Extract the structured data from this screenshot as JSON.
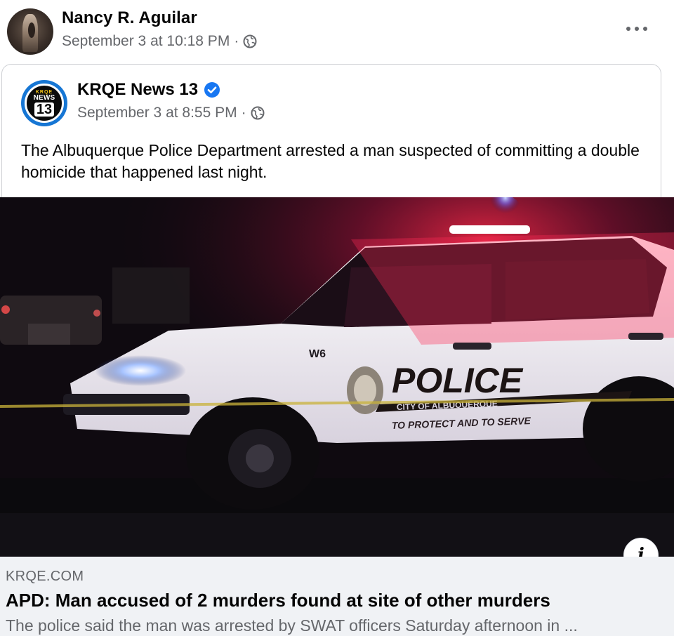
{
  "post": {
    "author_name": "Nancy R. Aguilar",
    "timestamp": "September 3 at 10:18 PM",
    "meta_separator": "·",
    "privacy_icon": "globe-icon",
    "more_icon": "more-options-icon"
  },
  "shared": {
    "page_name": "KRQE News 13",
    "verified_icon": "verified-badge-icon",
    "timestamp": "September 3 at 8:55 PM",
    "meta_separator": "·",
    "privacy_icon": "globe-icon",
    "logo": {
      "top_text": "KRQE",
      "middle_text": "NEWS",
      "bottom_text": "13"
    },
    "text": "The Albuquerque Police Department arrested a man suspected of committing a double homicide that happened last night."
  },
  "image": {
    "vehicle_unit": "W6",
    "vehicle_text": "POLICE",
    "vehicle_city": "CITY OF ALBUQUERQUE",
    "vehicle_motto": "TO PROTECT AND TO SERVE"
  },
  "link_preview": {
    "domain": "KRQE.COM",
    "title": "APD: Man accused of 2 murders found at site of other murders",
    "description": "The police said the man was arrested by SWAT officers Saturday afternoon in ...",
    "info_label": "i"
  },
  "colors": {
    "secondary_text": "#65676b",
    "verified_blue": "#1877f2",
    "footer_bg": "#f0f2f5"
  }
}
